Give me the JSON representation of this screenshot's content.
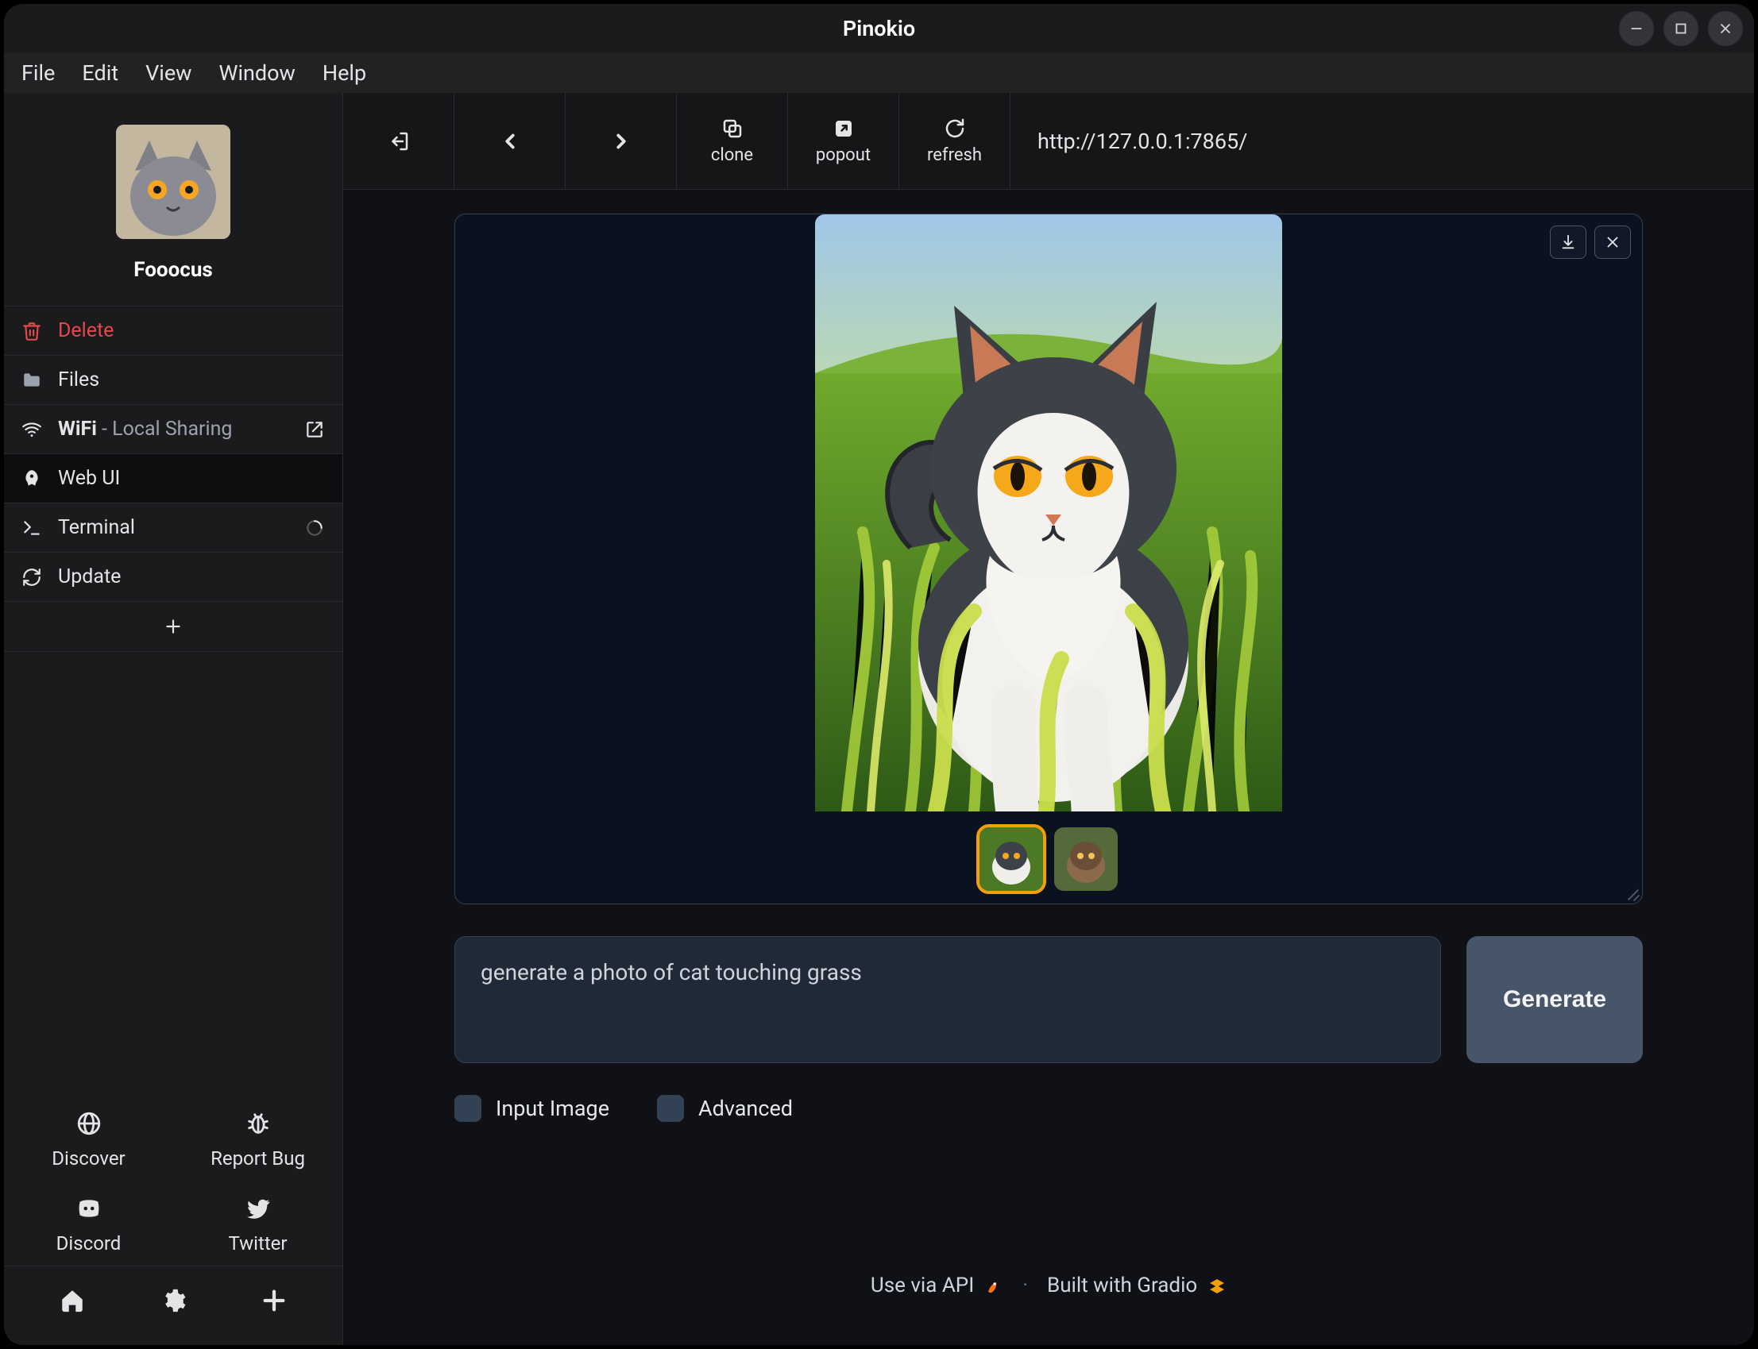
{
  "window": {
    "title": "Pinokio"
  },
  "menubar": [
    "File",
    "Edit",
    "View",
    "Window",
    "Help"
  ],
  "sidebar": {
    "app_name": "Fooocus",
    "items": [
      {
        "icon": "trash",
        "label": "Delete",
        "danger": true
      },
      {
        "icon": "folder",
        "label": "Files"
      },
      {
        "icon": "wifi",
        "label": "WiFi",
        "suffix": " - Local Sharing",
        "trail": "external"
      },
      {
        "icon": "rocket",
        "label": "Web UI",
        "active": true
      },
      {
        "icon": "terminal",
        "label": "Terminal",
        "trail": "spinner"
      },
      {
        "icon": "sync",
        "label": "Update"
      }
    ],
    "bottom_links": [
      {
        "icon": "globe",
        "label": "Discover"
      },
      {
        "icon": "bug",
        "label": "Report Bug"
      },
      {
        "icon": "discord",
        "label": "Discord"
      },
      {
        "icon": "twitter",
        "label": "Twitter"
      }
    ]
  },
  "toolbar": {
    "items": [
      {
        "id": "back-exit",
        "icon": "exit",
        "label": ""
      },
      {
        "id": "back",
        "icon": "chevron-left",
        "label": ""
      },
      {
        "id": "forward",
        "icon": "chevron-right",
        "label": ""
      },
      {
        "id": "clone",
        "icon": "copy",
        "label": "clone"
      },
      {
        "id": "popout",
        "icon": "popout",
        "label": "popout"
      },
      {
        "id": "refresh",
        "icon": "refresh",
        "label": "refresh"
      }
    ],
    "url": "http://127.0.0.1:7865/"
  },
  "gallery": {
    "thumbs": 2,
    "selected_thumb": 0
  },
  "prompt": {
    "value": "generate a photo of cat touching grass",
    "generate_label": "Generate"
  },
  "checks": {
    "input_image": "Input Image",
    "advanced": "Advanced"
  },
  "footer": {
    "api": "Use via API",
    "gradio": "Built with Gradio"
  }
}
